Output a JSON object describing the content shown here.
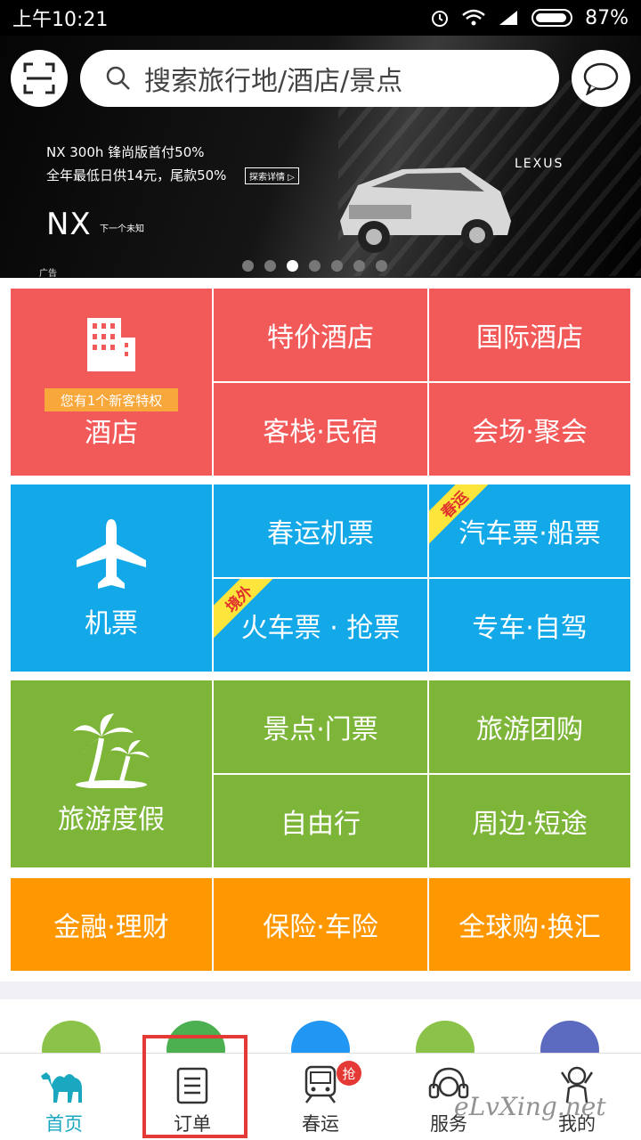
{
  "status_bar": {
    "time": "上午10:21",
    "battery": "87%"
  },
  "search": {
    "placeholder": "搜索旅行地/酒店/景点"
  },
  "banner": {
    "line1": "NX 300h 锋尚版首付50%",
    "line2": "全年最低日供14元，尾款50%",
    "detail": "探索详情 ▷",
    "model": "NX",
    "slogan": "下一个未知",
    "brand": "LEXUS",
    "ad_tag": "广告",
    "page_count": 7,
    "active_page": 3
  },
  "categories": {
    "hotel": {
      "title": "酒店",
      "ribbon": "您有1个新客特权",
      "items": [
        "特价酒店",
        "国际酒店",
        "客栈·民宿",
        "会场·聚会"
      ]
    },
    "flight": {
      "title": "机票",
      "items": [
        "春运机票",
        "汽车票·船票",
        "火车票 · 抢票",
        "专车·自驾"
      ],
      "corner_bus": "春运",
      "corner_train": "境外"
    },
    "travel": {
      "title": "旅游度假",
      "items": [
        "景点·门票",
        "旅游团购",
        "自由行",
        "周边·短途"
      ]
    },
    "finance": {
      "items": [
        "金融·理财",
        "保险·车险",
        "全球购·换汇"
      ]
    }
  },
  "colors": {
    "hotel": "#f25a5a",
    "flight": "#13a8e8",
    "travel": "#7cb538",
    "finance": "#ff9800",
    "nav_active": "#19a8c0"
  },
  "bottom_nav": {
    "home": "首页",
    "orders": "订单",
    "spring": "春运",
    "service": "服务",
    "mine": "我的",
    "badge": "抢"
  },
  "watermark": "eLvXing.net"
}
